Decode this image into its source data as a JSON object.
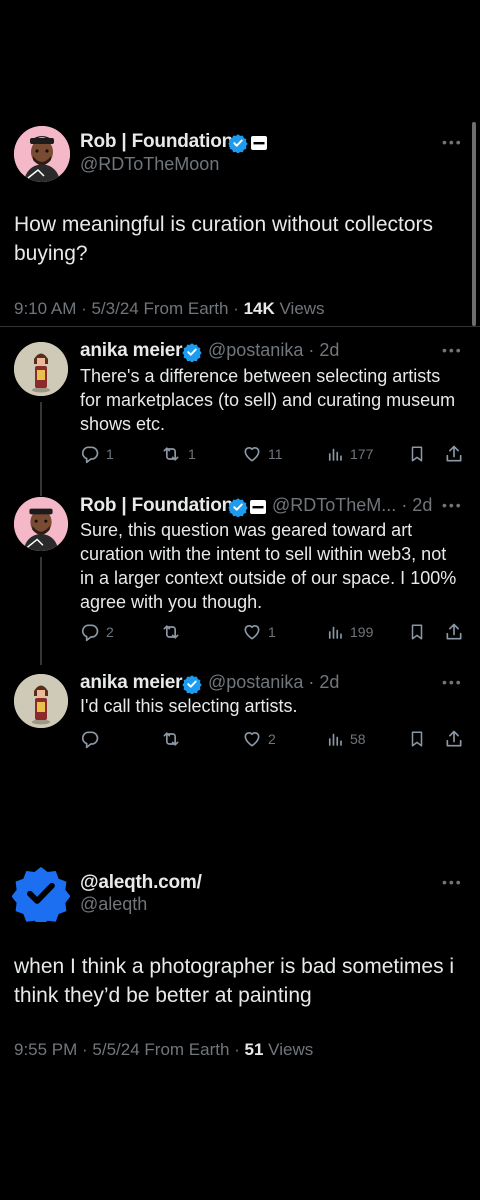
{
  "tweet1": {
    "author": "Rob | Foundation",
    "handle": "@RDToTheMoon",
    "text": "How meaningful is curation without collectors buying?",
    "time": "9:10 AM · 5/3/24 From Earth · ",
    "views_count": "14K",
    "views_label": " Views"
  },
  "replies": [
    {
      "author": "anika meier",
      "handle": "@postanika",
      "age": "· 2d",
      "text": "There's a difference between selecting artists for marketplaces (to sell) and curating museum shows etc.",
      "replies": "1",
      "retweets": "1",
      "likes": "11",
      "views": "177"
    },
    {
      "author": "Rob | Foundation",
      "handle": "@RDToTheM...",
      "age": "· 2d",
      "text": "Sure, this question was geared toward art curation with the intent to sell within web3, not in a larger context outside of our space. I 100% agree with you though.",
      "replies": "2",
      "retweets": "",
      "likes": "1",
      "views": "199"
    },
    {
      "author": "anika meier",
      "handle": "@postanika",
      "age": "· 2d",
      "text": "I'd call this selecting artists.",
      "replies": "",
      "retweets": "",
      "likes": "2",
      "views": "58"
    }
  ],
  "tweet2": {
    "author": "@aleqth.com/",
    "handle": "@aleqth",
    "text": "when I think a photographer is bad sometimes i think they’d be better at painting",
    "time": "9:55 PM · 5/5/24 From Earth · ",
    "views_count": "51",
    "views_label": " Views"
  },
  "icons": {
    "more": "more-icon",
    "verified": "verified-badge-icon",
    "affiliate": "affiliate-badge-icon",
    "reply": "reply-icon",
    "retweet": "retweet-icon",
    "like": "like-icon",
    "views": "views-icon",
    "bookmark": "bookmark-icon",
    "share": "share-icon"
  },
  "colors": {
    "background": "#000000",
    "verified": "#1d9bf0",
    "text": "#e7e9ea",
    "muted": "#71767b"
  }
}
